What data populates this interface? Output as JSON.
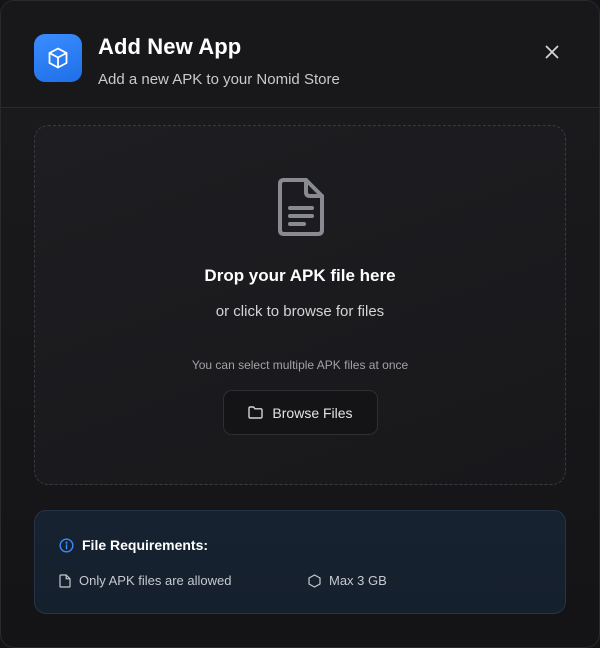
{
  "dialog": {
    "title": "Add New App",
    "subtitle": "Add a new APK to your Nomid Store",
    "header_icon": "package-cube-icon",
    "close_icon": "close-icon"
  },
  "dropzone": {
    "icon": "document-icon",
    "title": "Drop your APK file here",
    "subtitle": "or click to browse for files",
    "hint": "You can select multiple APK files at once",
    "browse_label": "Browse Files",
    "browse_icon": "folder-icon"
  },
  "requirements": {
    "title": "File Requirements:",
    "title_icon": "info-icon",
    "items": [
      {
        "icon": "file-icon",
        "text": "Only APK files are allowed"
      },
      {
        "icon": "hexagon-icon",
        "text": "Max 3 GB"
      }
    ]
  },
  "colors": {
    "accent": "#2f80f5",
    "background": "#141416",
    "info_panel": "#172231"
  }
}
